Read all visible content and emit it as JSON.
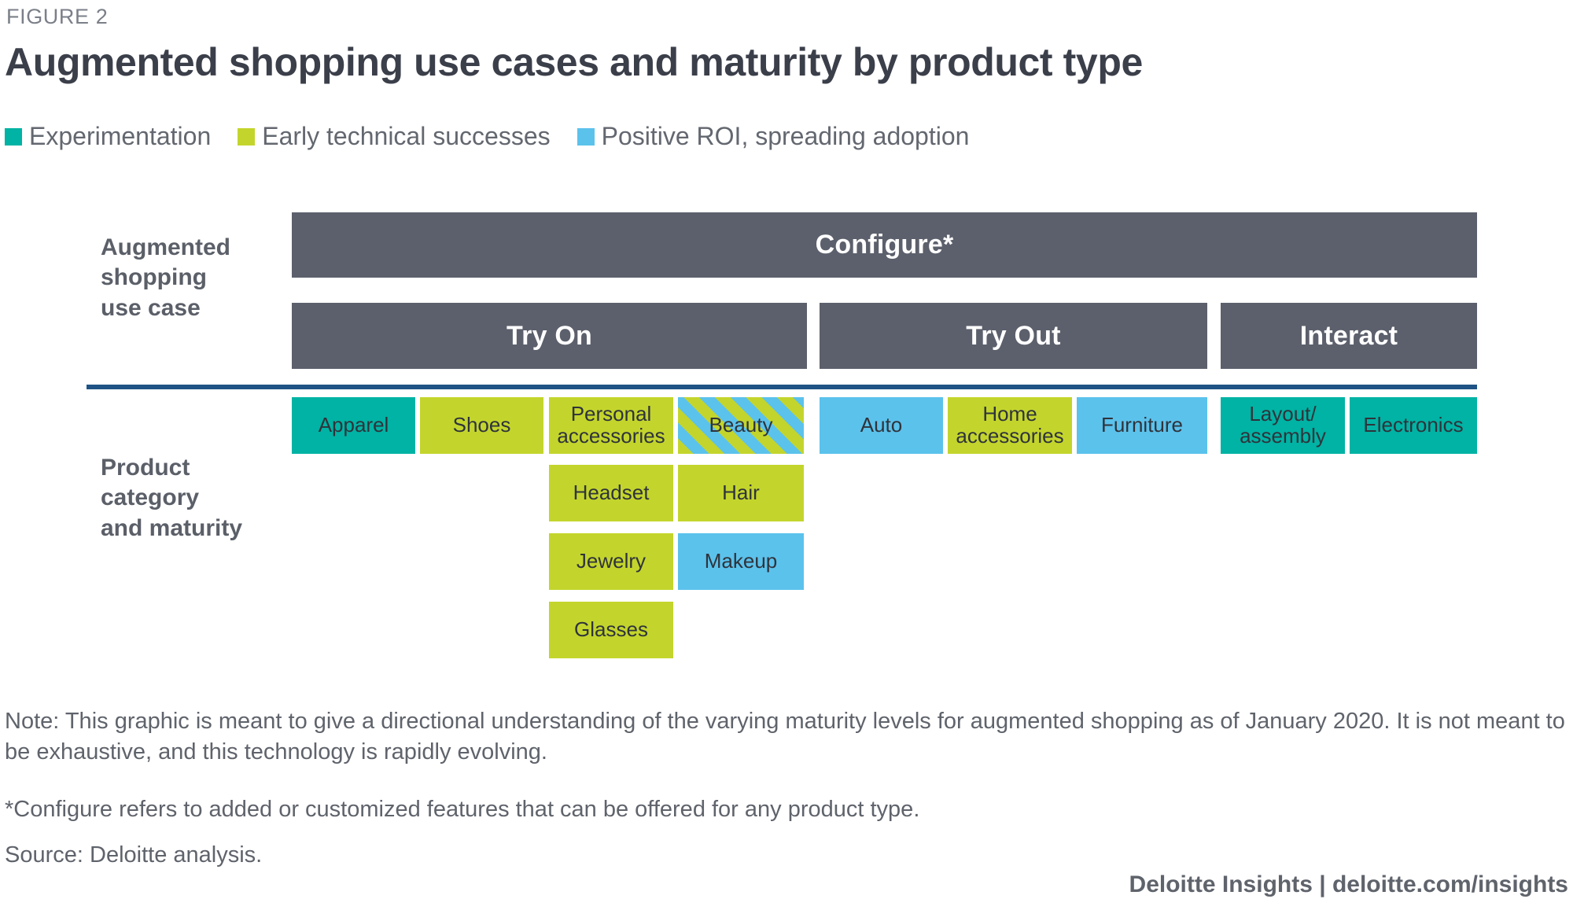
{
  "figure": {
    "label": "FIGURE 2",
    "title": "Augmented shopping use cases and maturity by product type"
  },
  "legend": {
    "items": [
      {
        "label": "Experimentation",
        "color": "#00b3a4",
        "key": "experimentation"
      },
      {
        "label": "Early technical successes",
        "color": "#c3d52c",
        "key": "early_technical_successes"
      },
      {
        "label": "Positive ROI, spreading adoption",
        "color": "#5bc2ec",
        "key": "positive_roi"
      }
    ]
  },
  "axis_labels": {
    "use_case": "Augmented shopping use case",
    "use_case_lines": [
      "Augmented",
      "shopping",
      "use case"
    ],
    "product": "Product category and maturity",
    "product_lines": [
      "Product",
      "category",
      "and maturity"
    ]
  },
  "colors": {
    "bar_gray": "#5c606c",
    "divider_blue": "#1f5386",
    "text_dark": "#3b3f4a",
    "text_gray": "#5f636b"
  },
  "chart_data": {
    "type": "table",
    "title": "Augmented shopping use cases and maturity by product type",
    "legend_position": "top-left",
    "maturity_levels": [
      {
        "key": "experimentation",
        "label": "Experimentation",
        "color": "#00b3a4"
      },
      {
        "key": "early_technical_successes",
        "label": "Early technical successes",
        "color": "#c3d52c"
      },
      {
        "key": "positive_roi",
        "label": "Positive ROI, spreading adoption",
        "color": "#5bc2ec"
      }
    ],
    "use_case_tiers": [
      {
        "label": "Configure*",
        "span": "all",
        "row": 1
      },
      {
        "label": "Try On",
        "row": 2
      },
      {
        "label": "Try Out",
        "row": 2
      },
      {
        "label": "Interact",
        "row": 2
      }
    ],
    "columns": [
      {
        "use_case": "Try On",
        "cells": [
          {
            "label": "Apparel",
            "maturity": "experimentation",
            "striped": false
          },
          {
            "label": "Shoes",
            "maturity": "early_technical_successes",
            "striped": false
          },
          {
            "label": "Personal accessories",
            "maturity": "early_technical_successes",
            "striped": false
          },
          {
            "label": "Headset",
            "maturity": "early_technical_successes",
            "striped": false
          },
          {
            "label": "Jewelry",
            "maturity": "early_technical_successes",
            "striped": false
          },
          {
            "label": "Glasses",
            "maturity": "early_technical_successes",
            "striped": false
          },
          {
            "label": "Beauty",
            "maturity": "early_technical_successes+positive_roi",
            "striped": true
          },
          {
            "label": "Hair",
            "maturity": "early_technical_successes",
            "striped": false
          },
          {
            "label": "Makeup",
            "maturity": "positive_roi",
            "striped": false
          }
        ]
      },
      {
        "use_case": "Try Out",
        "cells": [
          {
            "label": "Auto",
            "maturity": "positive_roi",
            "striped": false
          },
          {
            "label": "Home accessories",
            "maturity": "early_technical_successes",
            "striped": false
          },
          {
            "label": "Furniture",
            "maturity": "positive_roi",
            "striped": false
          }
        ]
      },
      {
        "use_case": "Interact",
        "cells": [
          {
            "label": "Layout/ assembly",
            "maturity": "experimentation",
            "striped": false
          },
          {
            "label": "Electronics",
            "maturity": "experimentation",
            "striped": false
          }
        ]
      }
    ]
  },
  "cells": {
    "apparel": {
      "l1": "Apparel",
      "l2": ""
    },
    "shoes": {
      "l1": "Shoes",
      "l2": ""
    },
    "personal": {
      "l1": "Personal",
      "l2": "accessories"
    },
    "beauty": {
      "l1": "Beauty",
      "l2": ""
    },
    "headset": {
      "l1": "Headset",
      "l2": ""
    },
    "hair": {
      "l1": "Hair",
      "l2": ""
    },
    "jewelry": {
      "l1": "Jewelry",
      "l2": ""
    },
    "makeup": {
      "l1": "Makeup",
      "l2": ""
    },
    "glasses": {
      "l1": "Glasses",
      "l2": ""
    },
    "auto": {
      "l1": "Auto",
      "l2": ""
    },
    "home_accessories": {
      "l1": "Home",
      "l2": "accessories"
    },
    "furniture": {
      "l1": "Furniture",
      "l2": ""
    },
    "layout_assembly": {
      "l1": "Layout/",
      "l2": "assembly"
    },
    "electronics": {
      "l1": "Electronics",
      "l2": ""
    }
  },
  "use_case_bars": {
    "configure": "Configure*",
    "try_on": "Try On",
    "try_out": "Try Out",
    "interact": "Interact"
  },
  "footnotes": {
    "note": "Note: This graphic is meant to give a directional understanding of the varying maturity levels for augmented shopping as of January 2020. It is not meant to be exhaustive, and this technology is rapidly evolving.",
    "asterisk": "*Configure refers to added or customized features that can be offered for any product type.",
    "source": "Source: Deloitte analysis.",
    "credit": "Deloitte Insights | deloitte.com/insights"
  }
}
